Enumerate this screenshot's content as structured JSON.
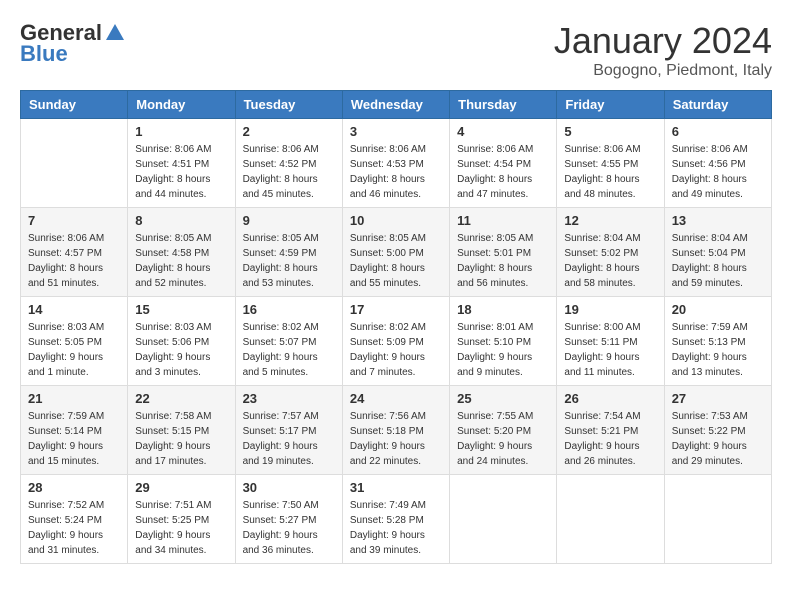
{
  "logo": {
    "general": "General",
    "blue": "Blue"
  },
  "title": {
    "month": "January 2024",
    "location": "Bogogno, Piedmont, Italy"
  },
  "headers": [
    "Sunday",
    "Monday",
    "Tuesday",
    "Wednesday",
    "Thursday",
    "Friday",
    "Saturday"
  ],
  "weeks": [
    [
      {
        "day": "",
        "info": ""
      },
      {
        "day": "1",
        "info": "Sunrise: 8:06 AM\nSunset: 4:51 PM\nDaylight: 8 hours\nand 44 minutes."
      },
      {
        "day": "2",
        "info": "Sunrise: 8:06 AM\nSunset: 4:52 PM\nDaylight: 8 hours\nand 45 minutes."
      },
      {
        "day": "3",
        "info": "Sunrise: 8:06 AM\nSunset: 4:53 PM\nDaylight: 8 hours\nand 46 minutes."
      },
      {
        "day": "4",
        "info": "Sunrise: 8:06 AM\nSunset: 4:54 PM\nDaylight: 8 hours\nand 47 minutes."
      },
      {
        "day": "5",
        "info": "Sunrise: 8:06 AM\nSunset: 4:55 PM\nDaylight: 8 hours\nand 48 minutes."
      },
      {
        "day": "6",
        "info": "Sunrise: 8:06 AM\nSunset: 4:56 PM\nDaylight: 8 hours\nand 49 minutes."
      }
    ],
    [
      {
        "day": "7",
        "info": "Sunrise: 8:06 AM\nSunset: 4:57 PM\nDaylight: 8 hours\nand 51 minutes."
      },
      {
        "day": "8",
        "info": "Sunrise: 8:05 AM\nSunset: 4:58 PM\nDaylight: 8 hours\nand 52 minutes."
      },
      {
        "day": "9",
        "info": "Sunrise: 8:05 AM\nSunset: 4:59 PM\nDaylight: 8 hours\nand 53 minutes."
      },
      {
        "day": "10",
        "info": "Sunrise: 8:05 AM\nSunset: 5:00 PM\nDaylight: 8 hours\nand 55 minutes."
      },
      {
        "day": "11",
        "info": "Sunrise: 8:05 AM\nSunset: 5:01 PM\nDaylight: 8 hours\nand 56 minutes."
      },
      {
        "day": "12",
        "info": "Sunrise: 8:04 AM\nSunset: 5:02 PM\nDaylight: 8 hours\nand 58 minutes."
      },
      {
        "day": "13",
        "info": "Sunrise: 8:04 AM\nSunset: 5:04 PM\nDaylight: 8 hours\nand 59 minutes."
      }
    ],
    [
      {
        "day": "14",
        "info": "Sunrise: 8:03 AM\nSunset: 5:05 PM\nDaylight: 9 hours\nand 1 minute."
      },
      {
        "day": "15",
        "info": "Sunrise: 8:03 AM\nSunset: 5:06 PM\nDaylight: 9 hours\nand 3 minutes."
      },
      {
        "day": "16",
        "info": "Sunrise: 8:02 AM\nSunset: 5:07 PM\nDaylight: 9 hours\nand 5 minutes."
      },
      {
        "day": "17",
        "info": "Sunrise: 8:02 AM\nSunset: 5:09 PM\nDaylight: 9 hours\nand 7 minutes."
      },
      {
        "day": "18",
        "info": "Sunrise: 8:01 AM\nSunset: 5:10 PM\nDaylight: 9 hours\nand 9 minutes."
      },
      {
        "day": "19",
        "info": "Sunrise: 8:00 AM\nSunset: 5:11 PM\nDaylight: 9 hours\nand 11 minutes."
      },
      {
        "day": "20",
        "info": "Sunrise: 7:59 AM\nSunset: 5:13 PM\nDaylight: 9 hours\nand 13 minutes."
      }
    ],
    [
      {
        "day": "21",
        "info": "Sunrise: 7:59 AM\nSunset: 5:14 PM\nDaylight: 9 hours\nand 15 minutes."
      },
      {
        "day": "22",
        "info": "Sunrise: 7:58 AM\nSunset: 5:15 PM\nDaylight: 9 hours\nand 17 minutes."
      },
      {
        "day": "23",
        "info": "Sunrise: 7:57 AM\nSunset: 5:17 PM\nDaylight: 9 hours\nand 19 minutes."
      },
      {
        "day": "24",
        "info": "Sunrise: 7:56 AM\nSunset: 5:18 PM\nDaylight: 9 hours\nand 22 minutes."
      },
      {
        "day": "25",
        "info": "Sunrise: 7:55 AM\nSunset: 5:20 PM\nDaylight: 9 hours\nand 24 minutes."
      },
      {
        "day": "26",
        "info": "Sunrise: 7:54 AM\nSunset: 5:21 PM\nDaylight: 9 hours\nand 26 minutes."
      },
      {
        "day": "27",
        "info": "Sunrise: 7:53 AM\nSunset: 5:22 PM\nDaylight: 9 hours\nand 29 minutes."
      }
    ],
    [
      {
        "day": "28",
        "info": "Sunrise: 7:52 AM\nSunset: 5:24 PM\nDaylight: 9 hours\nand 31 minutes."
      },
      {
        "day": "29",
        "info": "Sunrise: 7:51 AM\nSunset: 5:25 PM\nDaylight: 9 hours\nand 34 minutes."
      },
      {
        "day": "30",
        "info": "Sunrise: 7:50 AM\nSunset: 5:27 PM\nDaylight: 9 hours\nand 36 minutes."
      },
      {
        "day": "31",
        "info": "Sunrise: 7:49 AM\nSunset: 5:28 PM\nDaylight: 9 hours\nand 39 minutes."
      },
      {
        "day": "",
        "info": ""
      },
      {
        "day": "",
        "info": ""
      },
      {
        "day": "",
        "info": ""
      }
    ]
  ]
}
